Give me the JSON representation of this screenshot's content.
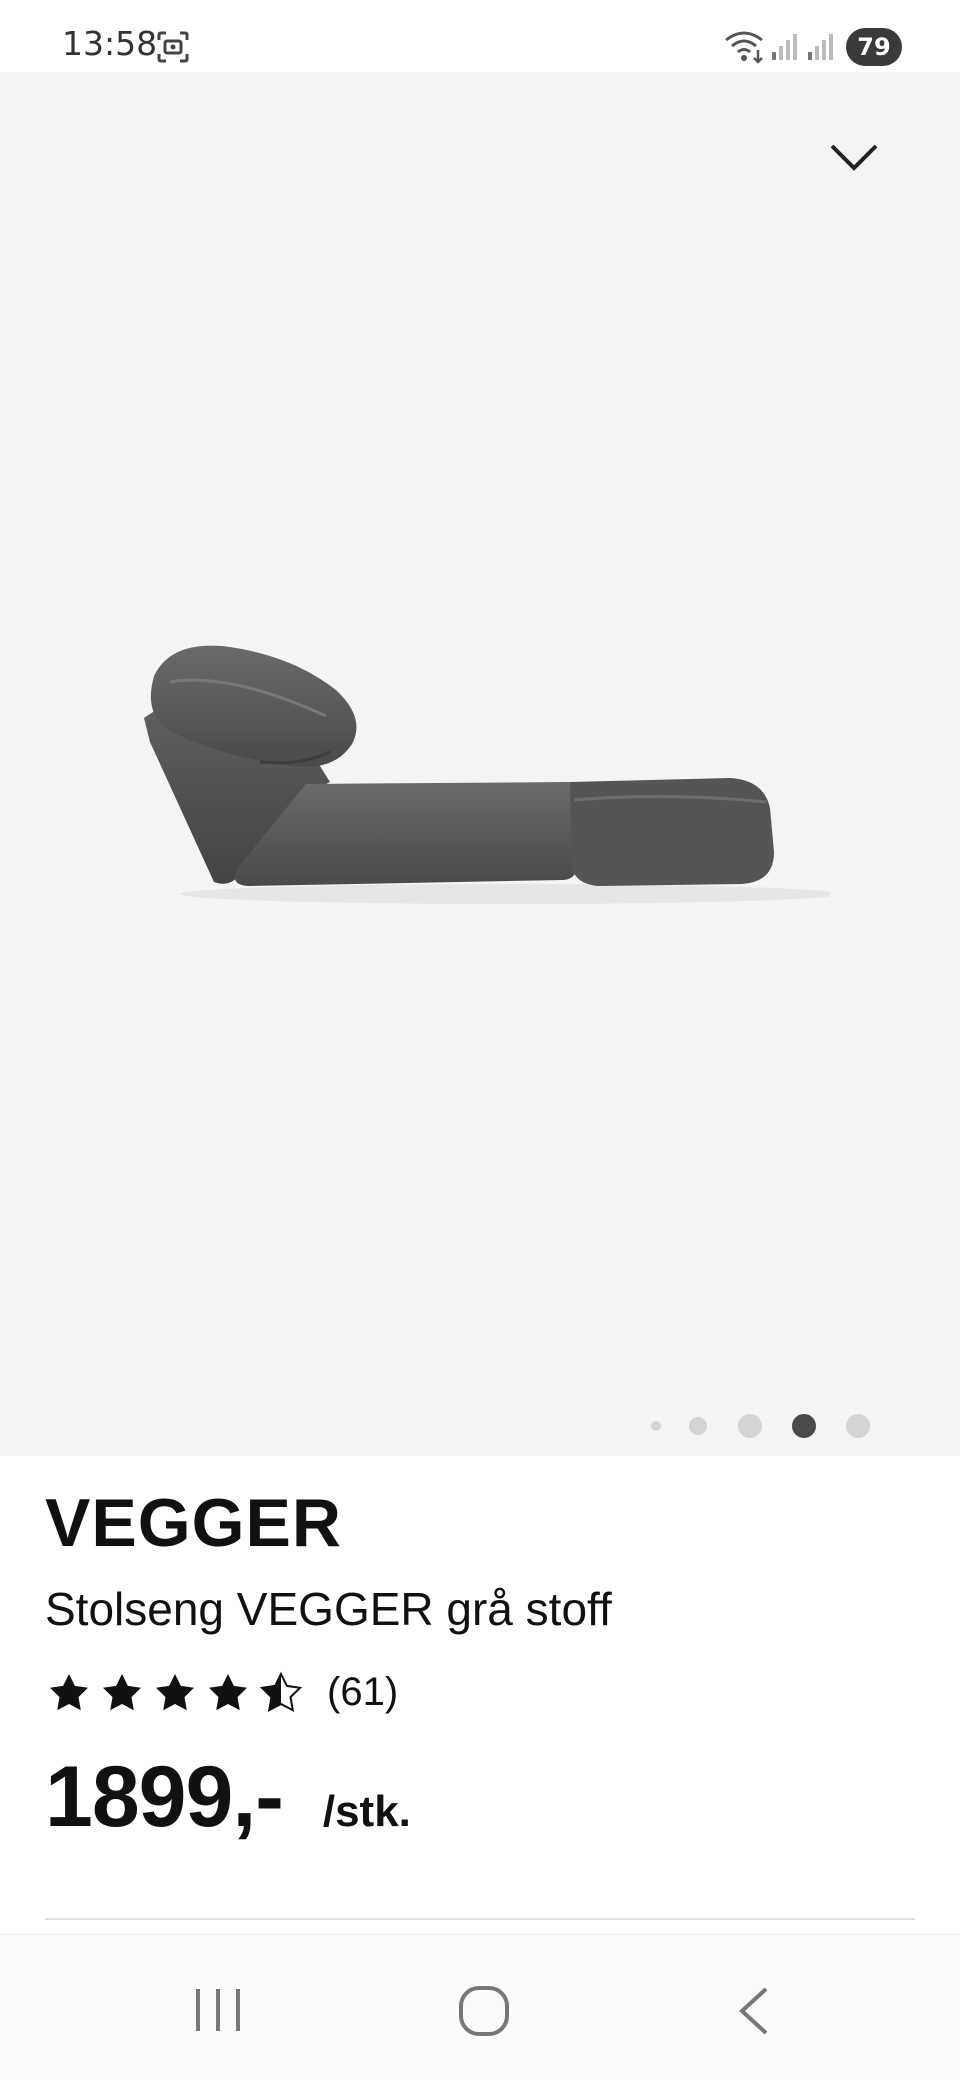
{
  "status_bar": {
    "time": "13:58",
    "battery": "79",
    "icons": [
      "screenshot-icon",
      "wifi-icon",
      "signal-icon",
      "signal-icon",
      "battery-icon"
    ]
  },
  "gallery": {
    "collapse_icon": "chevron-down-icon",
    "image": "gray-folding-chair-bed",
    "dots_count": 5,
    "active_dot_index": 3
  },
  "product": {
    "name": "VEGGER",
    "description": "Stolseng VEGGER grå stoff",
    "rating": {
      "value": 4.5,
      "max": 5,
      "count": "(61)"
    },
    "price": {
      "value": "1899,-",
      "unit": "/stk."
    }
  },
  "navigation": {
    "buttons": [
      "recents-icon",
      "home-icon",
      "back-icon"
    ]
  },
  "colors": {
    "image_background": "#f4f4f4",
    "text": "#111111",
    "active_dot": "#4a4a4a",
    "inactive_dot": "#d4d4d4"
  }
}
